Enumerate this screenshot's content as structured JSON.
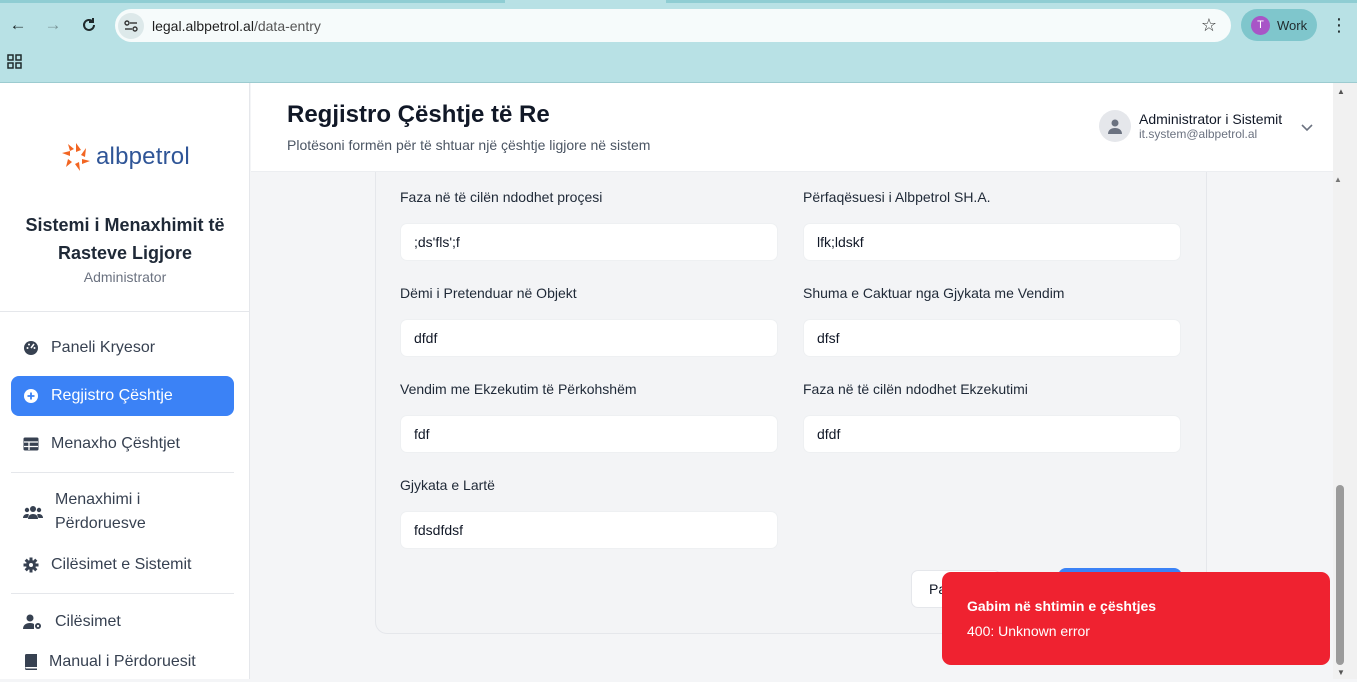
{
  "browser": {
    "url_domain": "legal.albpetrol.al",
    "url_path": "/data-entry",
    "profile_initial": "T",
    "profile_label": "Work"
  },
  "sidebar": {
    "logo_text": "albpetrol",
    "system_title": "Sistemi i Menaxhimit të Rasteve Ligjore",
    "role": "Administrator",
    "items": [
      {
        "label": "Paneli Kryesor",
        "icon": "dashboard-icon"
      },
      {
        "label": "Regjistro Çështje",
        "icon": "plus-circle-icon",
        "active": true
      },
      {
        "label": "Menaxho Çështjet",
        "icon": "table-icon"
      },
      {
        "label": "Menaxhimi i Përdoruesve",
        "icon": "users-icon"
      },
      {
        "label": "Cilësimet e Sistemit",
        "icon": "gear-icon"
      },
      {
        "label": "Cilësimet",
        "icon": "user-gear-icon"
      },
      {
        "label": "Manual i Përdoruesit",
        "icon": "book-icon"
      }
    ]
  },
  "header": {
    "title": "Regjistro Çështje të Re",
    "subtitle": "Plotësoni formën për të shtuar një çështje ligjore në sistem",
    "user_name": "Administrator i Sistemit",
    "user_email": "it.system@albpetrol.al"
  },
  "form": {
    "fields": [
      {
        "label": "Faza në të cilën ndodhet proçesi",
        "value": ";ds'fls';f"
      },
      {
        "label": "Përfaqësuesi i Albpetrol SH.A.",
        "value": "lfk;ldskf"
      },
      {
        "label": "Dëmi i Pretenduar në Objekt",
        "value": "dfdf"
      },
      {
        "label": "Shuma e Caktuar nga Gjykata me Vendim",
        "value": "dfsf"
      },
      {
        "label": "Vendim me Ekzekutim të Përkohshëm",
        "value": "fdf"
      },
      {
        "label": "Faza në të cilën ndodhet Ekzekutimi",
        "value": "dfdf"
      },
      {
        "label": "Gjykata e Lartë",
        "value": "fdsdfdsf"
      }
    ],
    "cancel_label_partial": "Pa"
  },
  "toast": {
    "title": "Gabim në shtimin e çështjes",
    "message": "400: Unknown error"
  },
  "colors": {
    "accent": "#3b82f6",
    "error": "#ef2230",
    "chrome": "#b8e1e5"
  }
}
